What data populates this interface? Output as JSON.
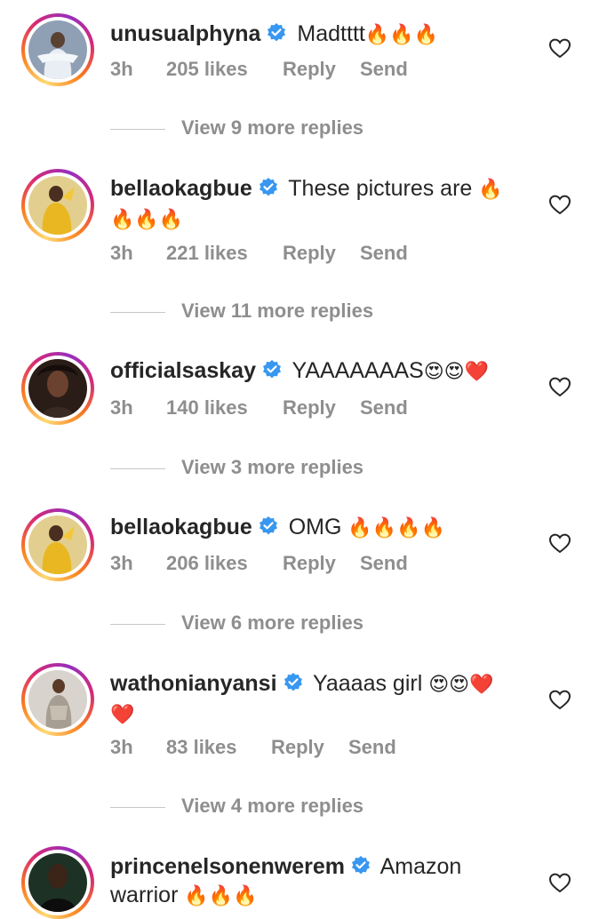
{
  "comments": [
    {
      "username": "unusualphyna",
      "text": "Madtttt",
      "emoji": "🔥🔥🔥",
      "time": "3h",
      "likes": "205 likes",
      "reply": "Reply",
      "send": "Send",
      "view_replies": "View 9 more replies",
      "avatar_color": "#9aa6b8"
    },
    {
      "username": "bellaokagbue",
      "text": "These pictures are",
      "emoji": "🔥",
      "emoji2": "🔥🔥🔥",
      "time": "3h",
      "likes": "221 likes",
      "reply": "Reply",
      "send": "Send",
      "view_replies": "View 11 more replies",
      "avatar_color": "#d9a72a"
    },
    {
      "username": "officialsaskay",
      "text": "YAAAAAAAS",
      "emoji": "😍😍❤️",
      "time": "3h",
      "likes": "140 likes",
      "reply": "Reply",
      "send": "Send",
      "view_replies": "View 3 more replies",
      "avatar_color": "#3b2a22"
    },
    {
      "username": "bellaokagbue",
      "text": "OMG",
      "emoji": "🔥🔥🔥🔥",
      "time": "3h",
      "likes": "206 likes",
      "reply": "Reply",
      "send": "Send",
      "view_replies": "View 6 more replies",
      "avatar_color": "#d9a72a"
    },
    {
      "username": "wathonianyansi",
      "text": "Yaaaas girl",
      "emoji": "😍😍❤️",
      "emoji2": "❤️",
      "time": "3h",
      "likes": "83 likes",
      "reply": "Reply",
      "send": "Send",
      "view_replies": "View 4 more replies",
      "avatar_color": "#b9b2ab"
    },
    {
      "username": "princenelsonenwerem",
      "text": "Amazon",
      "text2": "warrior",
      "emoji2": "🔥🔥🔥",
      "avatar_color": "#1f3326"
    }
  ],
  "colors": {
    "primary_text": "#262626",
    "secondary_text": "#8e8e8e",
    "verified_blue": "#3897f0",
    "fire": "#ff8c1a",
    "heart_red": "#e0112b"
  },
  "icons": {
    "verified": "verified-badge-icon",
    "like": "heart-outline-icon"
  }
}
